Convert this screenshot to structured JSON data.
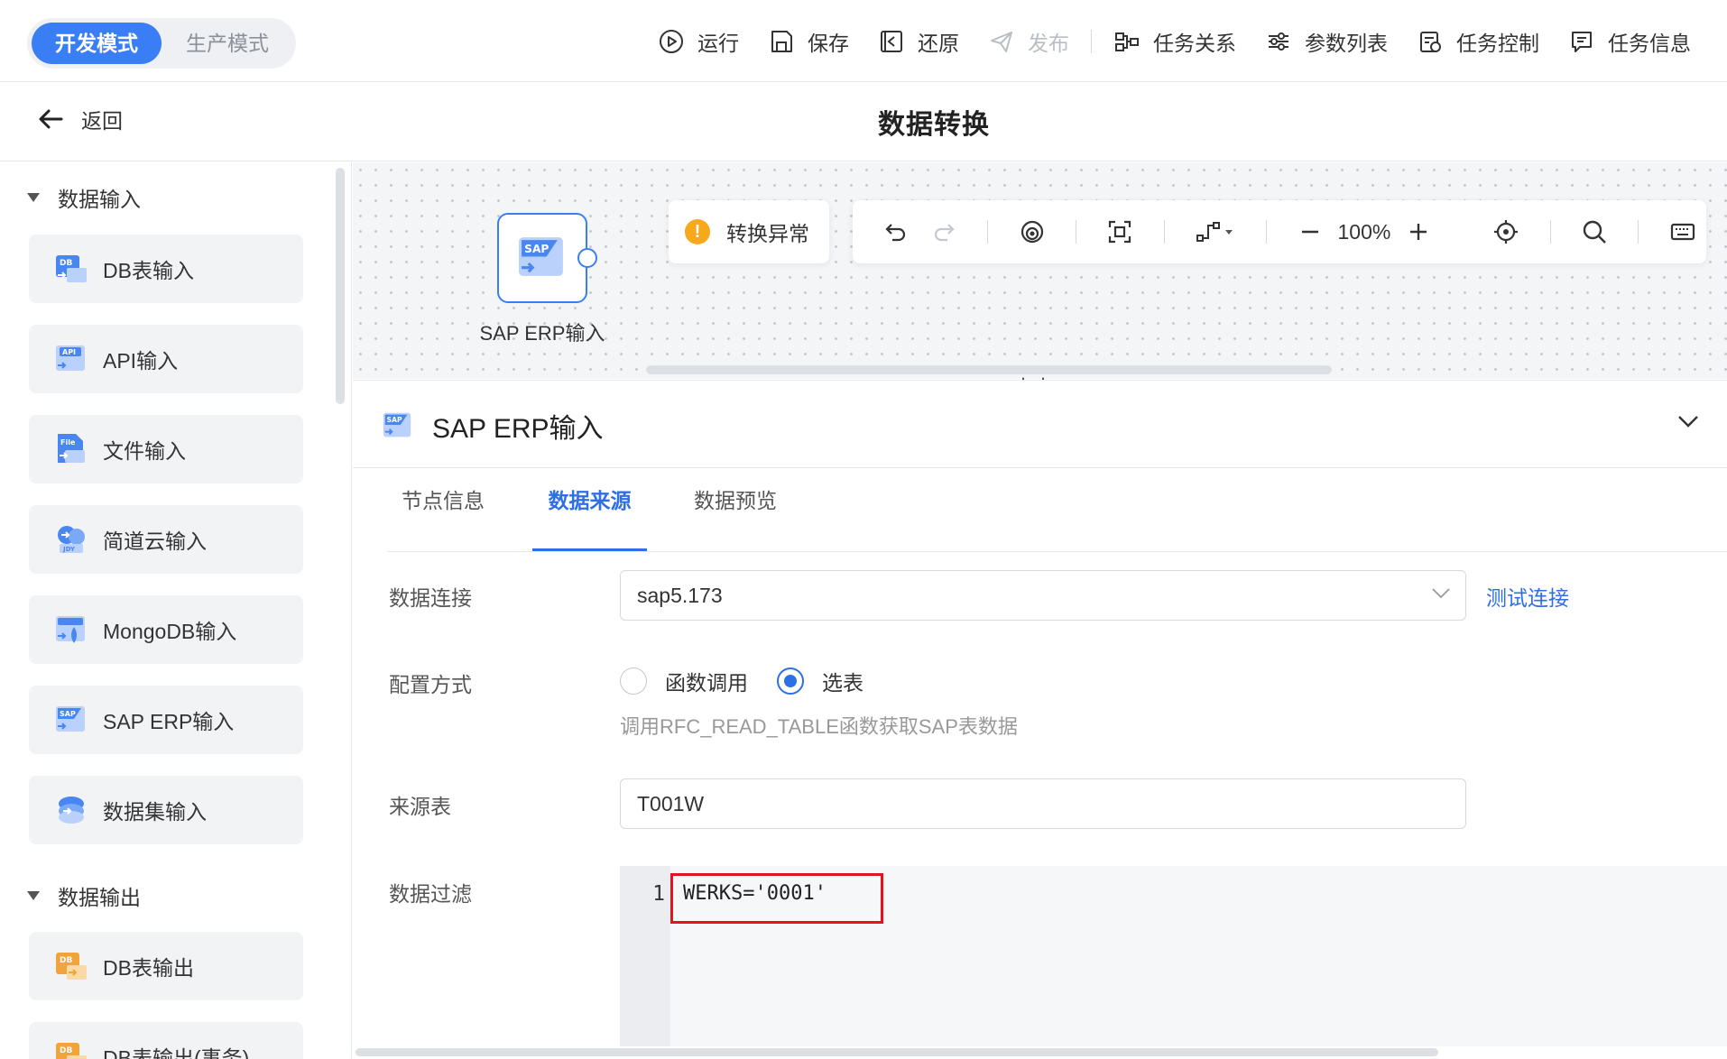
{
  "modes": {
    "dev": "开发模式",
    "prod": "生产模式"
  },
  "toolbar": {
    "run": "运行",
    "save": "保存",
    "restore": "还原",
    "publish": "发布",
    "task_relation": "任务关系",
    "param_list": "参数列表",
    "task_control": "任务控制",
    "task_info": "任务信息"
  },
  "header": {
    "back": "返回",
    "title": "数据转换"
  },
  "sidebar": {
    "input_group": "数据输入",
    "inputs": [
      {
        "label": "DB表输入",
        "icon": "db-input-icon"
      },
      {
        "label": "API输入",
        "icon": "api-input-icon"
      },
      {
        "label": "文件输入",
        "icon": "file-input-icon"
      },
      {
        "label": "简道云输入",
        "icon": "jdy-input-icon"
      },
      {
        "label": "MongoDB输入",
        "icon": "mongodb-input-icon"
      },
      {
        "label": "SAP ERP输入",
        "icon": "sap-input-icon"
      },
      {
        "label": "数据集输入",
        "icon": "dataset-input-icon"
      }
    ],
    "output_group": "数据输出",
    "outputs": [
      {
        "label": "DB表输出",
        "icon": "db-output-icon"
      },
      {
        "label": "DB表输出(事务)",
        "icon": "db-output-tx-icon"
      }
    ]
  },
  "canvas": {
    "node_label": "SAP ERP输入",
    "warning": "转换异常",
    "zoom": "100%"
  },
  "panel": {
    "title": "SAP ERP输入",
    "tabs": [
      "节点信息",
      "数据来源",
      "数据预览"
    ],
    "active_tab": "数据来源",
    "connection_label": "数据连接",
    "connection_value": "sap5.173",
    "test_connection": "测试连接",
    "config_label": "配置方式",
    "config_options": [
      "函数调用",
      "选表"
    ],
    "config_selected": "选表",
    "config_hint": "调用RFC_READ_TABLE函数获取SAP表数据",
    "source_table_label": "来源表",
    "source_table_value": "T001W",
    "filter_label": "数据过滤",
    "filter_line_no": "1",
    "filter_code": "WERKS='0001'"
  },
  "colors": {
    "accent": "#2f6fe4",
    "mode_active": "#3a7ef5",
    "warning": "#f7a81b",
    "highlight": "#e3141b"
  }
}
